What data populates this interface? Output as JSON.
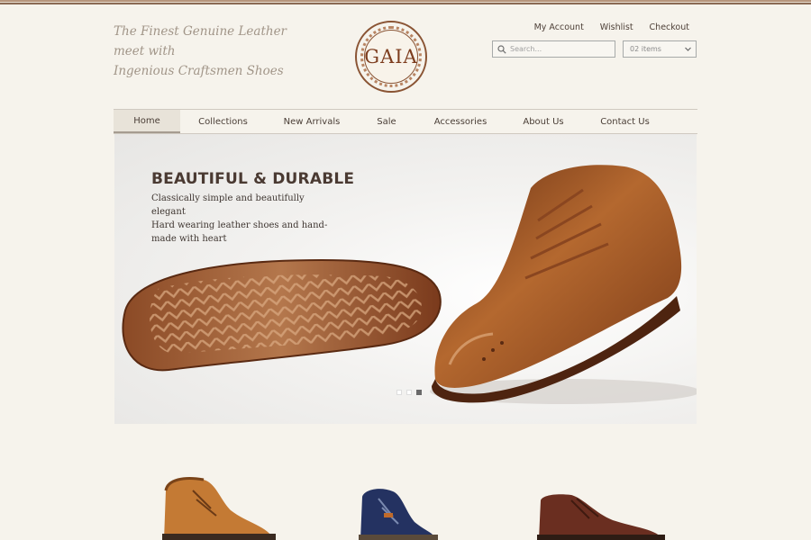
{
  "header": {
    "tagline_line1": "The Finest Genuine Leather meet with",
    "tagline_line2": "Ingenious Craftsmen Shoes",
    "logo_text": "GAIA",
    "account_links": [
      "My Account",
      "Wishlist",
      "Checkout"
    ],
    "search_placeholder": "Search...",
    "cart_select_value": "02 items"
  },
  "nav": {
    "items": [
      "Home",
      "Collections",
      "New Arrivals",
      "Sale",
      "Accessories",
      "About Us",
      "Contact Us"
    ],
    "active": "Home"
  },
  "hero": {
    "title": "BEAUTIFUL & DURABLE",
    "copy_lines": [
      "Classically simple and beautifully elegant",
      "Hard wearing leather shoes and hand-",
      "made with heart"
    ],
    "slide_count": 3,
    "active_slide": 3
  },
  "products": [
    {
      "icon": "tan-leather-boot"
    },
    {
      "icon": "navy-suede-boot"
    },
    {
      "icon": "brown-leather-boot"
    }
  ],
  "colors": {
    "background": "#f6f3ec",
    "brand_brown": "#7d3d1e",
    "leather": "#a0582a"
  }
}
